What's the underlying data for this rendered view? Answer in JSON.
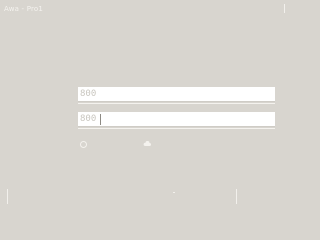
{
  "window": {
    "title": "Awa - Pro1"
  },
  "form": {
    "field1": {
      "value": "800"
    },
    "field2": {
      "value": "800"
    }
  },
  "icons": {
    "radio": "radio-icon",
    "cloud": "cloud-icon"
  },
  "colors": {
    "background": "#d8d5cf",
    "field_background": "#ffffff",
    "field_text": "#c9c6bf",
    "accent_white": "#f4f2ee"
  }
}
